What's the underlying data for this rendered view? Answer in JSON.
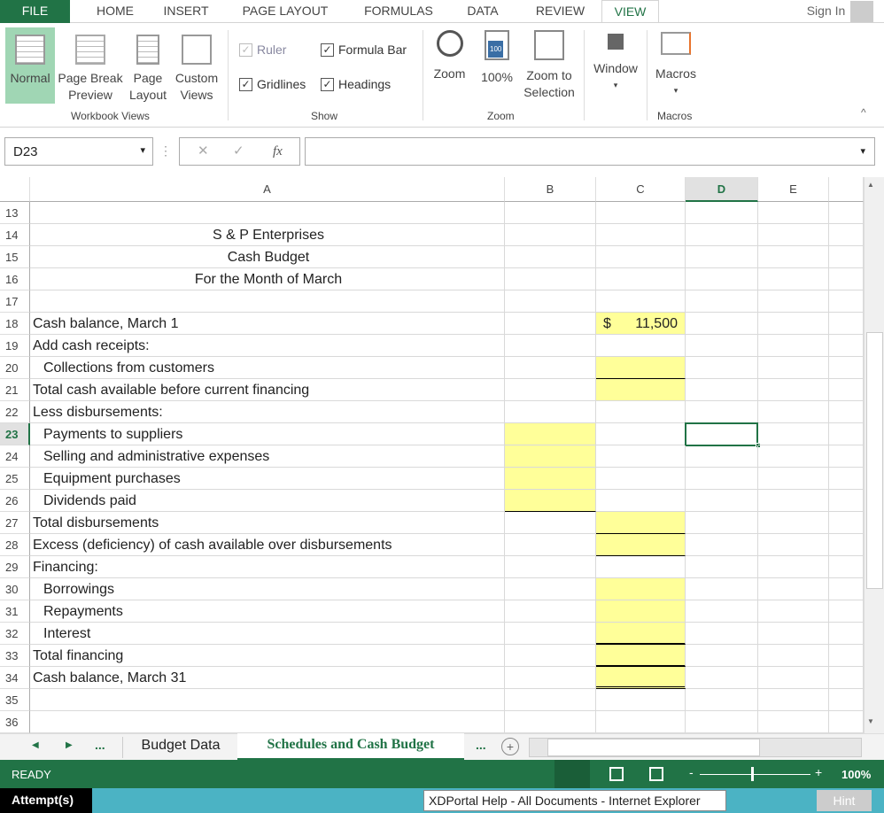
{
  "tabs": [
    "FILE",
    "HOME",
    "INSERT",
    "PAGE LAYOUT",
    "FORMULAS",
    "DATA",
    "REVIEW",
    "VIEW"
  ],
  "active_tab": "VIEW",
  "sign_in": "Sign In",
  "ribbon": {
    "workbook_views": {
      "label": "Workbook Views",
      "buttons": [
        "Normal",
        "Page Break Preview",
        "Page Layout",
        "Custom Views"
      ]
    },
    "show": {
      "label": "Show",
      "checks": [
        {
          "label": "Ruler",
          "checked": true,
          "disabled": true
        },
        {
          "label": "Formula Bar",
          "checked": true
        },
        {
          "label": "Gridlines",
          "checked": true
        },
        {
          "label": "Headings",
          "checked": true
        }
      ]
    },
    "zoom": {
      "label": "Zoom",
      "buttons": [
        "Zoom",
        "100%",
        "Zoom to Selection"
      ],
      "icon_text": "100"
    },
    "window": {
      "label": "Window"
    },
    "macros": {
      "label": "Macros",
      "button": "Macros"
    }
  },
  "formula_bar": {
    "name_box": "D23",
    "fx": "fx",
    "formula": ""
  },
  "columns": [
    "A",
    "B",
    "C",
    "D",
    "E"
  ],
  "selected_cell": "D23",
  "rows": [
    {
      "n": 13
    },
    {
      "n": 14,
      "a": "S & P Enterprises",
      "center": true
    },
    {
      "n": 15,
      "a": "Cash Budget",
      "center": true
    },
    {
      "n": 16,
      "a": "For the Month of March",
      "center": true
    },
    {
      "n": 17
    },
    {
      "n": 18,
      "a": "Cash balance, March 1",
      "c_sym": "$",
      "c": "11,500",
      "cy": true
    },
    {
      "n": 19,
      "a": "Add cash receipts:"
    },
    {
      "n": 20,
      "a": "Collections from customers",
      "indent": true,
      "cy": true,
      "cb": "bt"
    },
    {
      "n": 21,
      "a": "Total cash available before current financing",
      "cy": true
    },
    {
      "n": 22,
      "a": "Less disbursements:"
    },
    {
      "n": 23,
      "a": "Payments to suppliers",
      "indent": true,
      "by": true
    },
    {
      "n": 24,
      "a": "Selling and administrative expenses",
      "indent": true,
      "by": true
    },
    {
      "n": 25,
      "a": "Equipment purchases",
      "indent": true,
      "by": true
    },
    {
      "n": 26,
      "a": "Dividends paid",
      "indent": true,
      "by": true,
      "bb": "bt"
    },
    {
      "n": 27,
      "a": "Total disbursements",
      "cy": true,
      "cb": "bt"
    },
    {
      "n": 28,
      "a": "Excess (deficiency) of cash available over disbursements",
      "cy": true,
      "cb": "bt"
    },
    {
      "n": 29,
      "a": "Financing:"
    },
    {
      "n": 30,
      "a": "Borrowings",
      "indent": true,
      "cy": true
    },
    {
      "n": 31,
      "a": "Repayments",
      "indent": true,
      "cy": true
    },
    {
      "n": 32,
      "a": "Interest",
      "indent": true,
      "cy": true,
      "cb": "bthick"
    },
    {
      "n": 33,
      "a": "Total financing",
      "cy": true,
      "cb": "bthick"
    },
    {
      "n": 34,
      "a": "Cash balance, March 31",
      "cy": true,
      "cb": "bdbl"
    },
    {
      "n": 35
    },
    {
      "n": 36
    }
  ],
  "sheet_tabs": [
    "Budget Data",
    "Schedules and Cash Budget"
  ],
  "active_sheet": "Schedules and Cash Budget",
  "sheet_nav": {
    "prev": "◀",
    "next": "▶",
    "more": "...",
    "add": "+"
  },
  "status": {
    "text": "READY",
    "zoom": "100%"
  },
  "attempt": {
    "label": "Attempt(s)",
    "tooltip": "XDPortal Help - All Documents - Internet Explorer",
    "hint": "Hint"
  },
  "colors": {
    "accent": "#217346",
    "input_fill": "#ffff99",
    "attempt_bar": "#4bb3c4"
  }
}
